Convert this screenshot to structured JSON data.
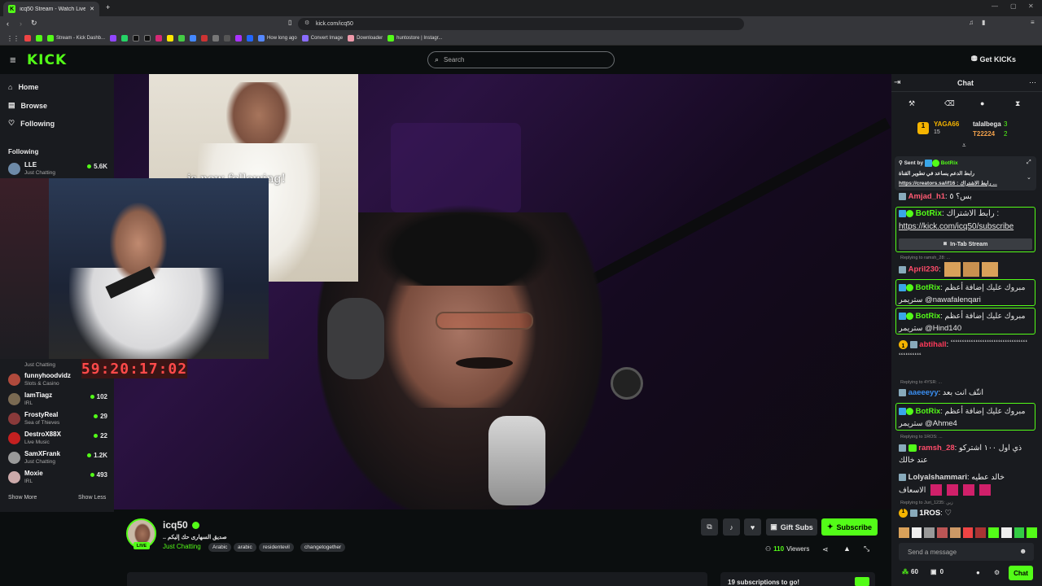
{
  "browser": {
    "tab_title": "icq50 Stream - Watch Live on Ki",
    "new_tab": "+",
    "url": "kick.com/icq50",
    "bookmarks": [
      "Stream - Kick Dashb...",
      "How long ago",
      "Convert Image",
      "Downloader",
      "huntostore | Instagr..."
    ]
  },
  "header": {
    "logo": "KICK",
    "search_placeholder": "Search",
    "get_kicks": "Get KICKs"
  },
  "sidebar": {
    "nav": [
      {
        "label": "Home",
        "icon": "home-icon"
      },
      {
        "label": "Browse",
        "icon": "browse-icon"
      },
      {
        "label": "Following",
        "icon": "heart-icon"
      }
    ],
    "following_heading": "Following",
    "channels": [
      {
        "name": "LLE",
        "category": "Just Chatting",
        "viewers": "5.6K",
        "color": "#6d8aa8"
      },
      {
        "name": "",
        "category": "Just Chatting",
        "viewers": "",
        "color": "#555"
      },
      {
        "name": "funnyhoodvidz",
        "category": "Slots & Casino",
        "viewers": "",
        "color": "#b04a3c"
      },
      {
        "name": "lamTiagz",
        "category": "IRL",
        "viewers": "102",
        "color": "#7a6a52"
      },
      {
        "name": "FrostyReal",
        "category": "Sea of Thieves",
        "viewers": "29",
        "color": "#8a3a3a"
      },
      {
        "name": "DestroX88X",
        "category": "Live Music",
        "viewers": "22",
        "color": "#c42020"
      },
      {
        "name": "SamXFrank",
        "category": "Just Chatting",
        "viewers": "1.2K",
        "color": "#9a9a9a"
      },
      {
        "name": "Moxie",
        "category": "IRL",
        "viewers": "493",
        "color": "#caa"
      }
    ],
    "show_more": "Show More",
    "show_less": "Show Less"
  },
  "video": {
    "alert_text": "is now following!",
    "timer": "59:20:17:02"
  },
  "stream": {
    "channel": "icq50",
    "live": "LIVE",
    "title": "صديق السهارى حك إليكم ..",
    "category": "Just Chatting",
    "tags": [
      "Arabic",
      "arabic",
      "residentevil",
      "changetogether"
    ],
    "viewers": "110",
    "viewers_label": "Viewers",
    "gift_subs": "Gift Subs",
    "subscribe": "Subscribe",
    "sub_goal": "19 subscriptions to go!"
  },
  "chat": {
    "title": "Chat",
    "leaderboard": [
      {
        "name": "YAGA66",
        "count": "15",
        "rank": "1"
      },
      {
        "name": "talalbega",
        "count": "3"
      },
      {
        "name": "T22224",
        "count": "2"
      }
    ],
    "pinned": {
      "sent_by": "Sent by",
      "bot": "BotRix",
      "line1": "رابط الدعم يساعد في تطوير القناة",
      "line2": "https://creators.sa/if16 : رابط الاشتراك ..."
    },
    "messages": [
      {
        "user": "Amjad_h1",
        "text": "بس؟ ٥"
      },
      {
        "user": "BotRix",
        "text": "رابط الاشتراك :",
        "link": "https://kick.com/icq50/subscribe",
        "button": "In-Tab Stream"
      },
      {
        "reply": "Replying to ramsh_28: ...",
        "user": "April230",
        "text": ""
      },
      {
        "user": "BotRix",
        "text": "مبروك عليك إضافة أعظم ستريمر @nawafalenqari"
      },
      {
        "user": "BotRix",
        "text": "مبروك عليك إضافة أعظم ستريمر @Hind140"
      },
      {
        "user": "abtihall",
        "text": "ٴٴٴٴٴٴٴٴٴٴٴٴٴٴٴٴٴٴٴٴٴٴٴٴٴٴٴٴٴٴٴٴٴٴٴٴٴٴٴٴٴٴٴٴ"
      },
      {
        "reply": "Replying to 4YSR: ...",
        "user": "aaeeeyy",
        "text": "انتّف انت بعد"
      },
      {
        "user": "BotRix",
        "text": "مبروك عليك إضافة أعظم ستريمر @Ahme4"
      },
      {
        "reply": "Replying to 1ROS: ...",
        "user": "ramsh_28",
        "text": "ذي اول ١٠٠ اشتركو عند خالك"
      },
      {
        "user": "Lolyalshammari",
        "text": "خالد عطيه الاسعاف"
      },
      {
        "reply": "Replying to Juri_1235: زين",
        "user": "1ROS",
        "text": "♡"
      }
    ],
    "input_placeholder": "Send a message",
    "points": "60",
    "gifts": "0",
    "send": "Chat"
  }
}
